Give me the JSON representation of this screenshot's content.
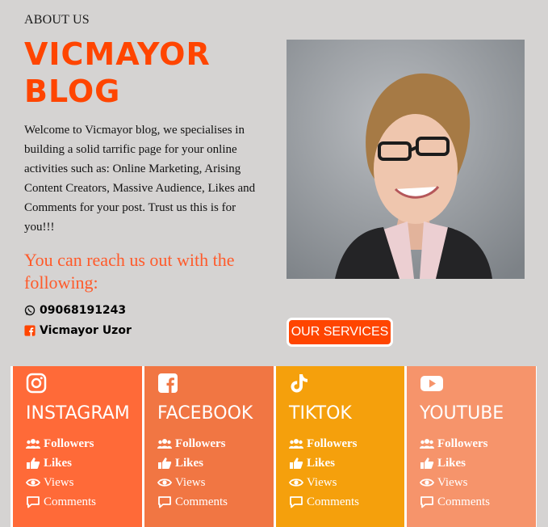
{
  "about": {
    "label": "ABOUT US",
    "brand_line1": "VICMAYOR",
    "brand_line2": "BLOG",
    "intro": "Welcome to Vicmayor blog, we specialises in building a solid tarrific page for your online activities such as: Online Marketing, Arising Content Creators, Massive Audience, Likes and Comments for your post. Trust us this is for you!!!",
    "reach": "You can reach us out with the following:",
    "phone": "09068191243",
    "facebook_name": "Vicmayor Uzor"
  },
  "services_button": "OUR SERVICES",
  "colors": {
    "accent": "#ff4500",
    "background": "#d5d3d2",
    "instagram": "#ff6a38",
    "facebook": "#f17643",
    "tiktok": "#f5a00c",
    "youtube": "#f6946b"
  },
  "cards": [
    {
      "platform": "INSTAGRAM",
      "icon": "instagram-icon",
      "followers": "Followers",
      "likes": "Likes",
      "views": "Views",
      "comments": "Comments"
    },
    {
      "platform": "FACEBOOK",
      "icon": "facebook-icon",
      "followers": "Followers",
      "likes": "Likes",
      "views": "Views",
      "comments": "Comments"
    },
    {
      "platform": "TIKTOK",
      "icon": "tiktok-icon",
      "followers": "Followers",
      "likes": "Likes",
      "views": "Views",
      "comments": "Comments"
    },
    {
      "platform": "YOUTUBE",
      "icon": "youtube-icon",
      "followers": "Followers",
      "likes": "Likes",
      "views": "Views",
      "comments": "Comments"
    }
  ]
}
